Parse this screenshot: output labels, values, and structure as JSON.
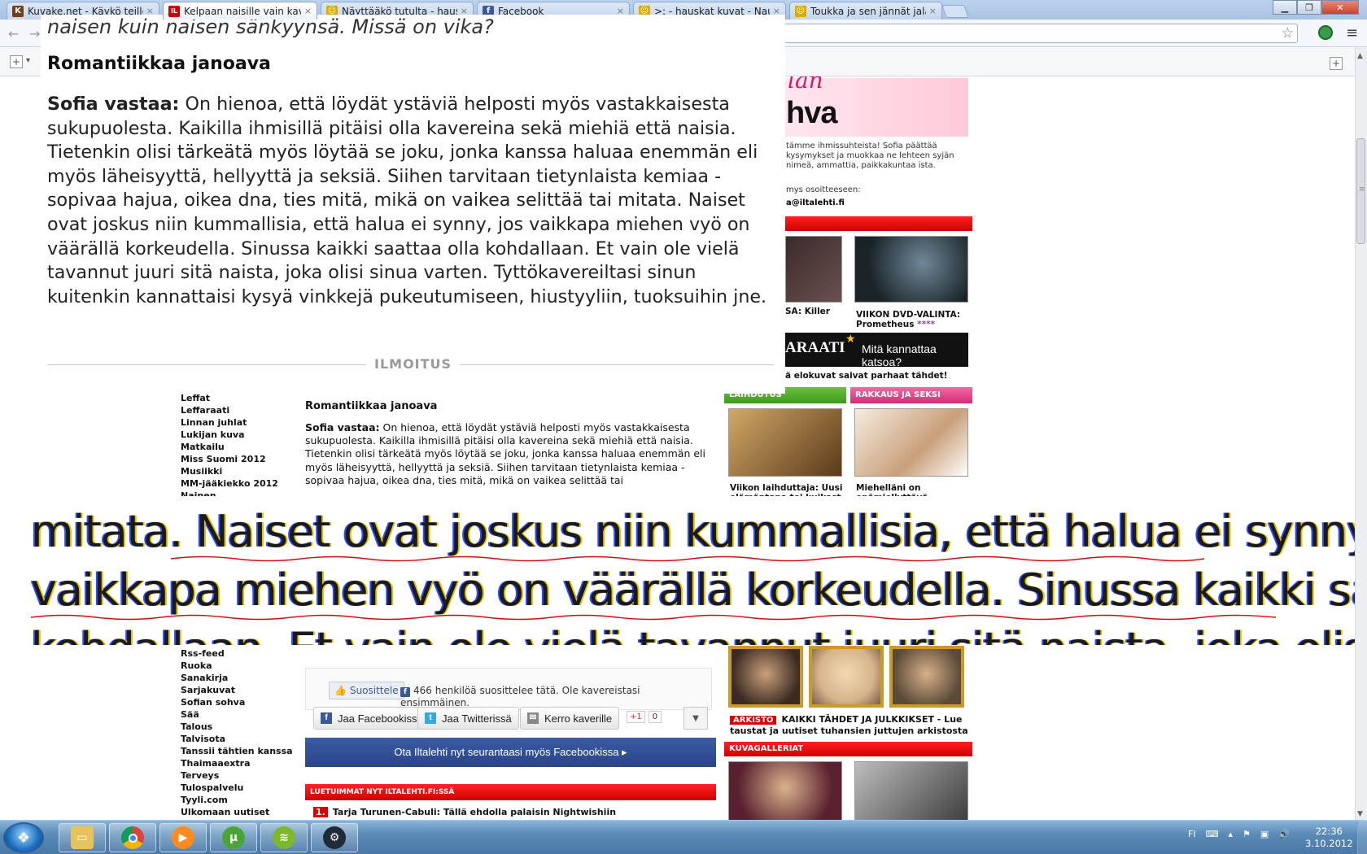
{
  "tabs": [
    {
      "label": "Kuvake.net - Käykö teille n",
      "fav": "K",
      "favColor": "#7a3b12"
    },
    {
      "label": "Kelpaan naisille vain kaveri",
      "fav": "IL",
      "favColor": "#d40000"
    },
    {
      "label": "Näyttääkö tutulta - hauska",
      "fav": "☺",
      "favColor": "#e0a800"
    },
    {
      "label": "Facebook",
      "fav": "f",
      "favColor": "#3b5998"
    },
    {
      "label": ">: - hauskat kuvat - Nauru",
      "fav": "☺",
      "favColor": "#e0a800"
    },
    {
      "label": "Toukka ja sen jännät jalat -",
      "fav": "☺",
      "favColor": "#e0a800"
    }
  ],
  "tab_close": "×",
  "window": {
    "min": "▁",
    "max": "❐",
    "close": "✕"
  },
  "icons": {
    "back": "←",
    "forward": "→",
    "star": "☆",
    "menu": "≡",
    "add": "+",
    "dropdown": "▾",
    "up": "▲",
    "down": "▼",
    "grip": "≡"
  },
  "magnified_top": {
    "intro_line": "naisen kuin naisen sänkyynsä. Missä on vika?",
    "heading": "Romantiikkaa janoava",
    "answer_label": "Sofia vastaa:",
    "answer_text": " On hienoa, että löydät ystäviä helposti myös vastakkaisesta sukupuolesta. Kaikilla ihmisillä pitäisi olla kavereina sekä miehiä että naisia. Tietenkin olisi tärkeätä myös löytää se joku, jonka kanssa haluaa enemmän eli myös läheisyyttä, hellyyttä ja seksiä. Siihen tarvitaan tietynlaista kemiaa - sopivaa hajua, oikea dna, ties mitä, mikä on vaikea selittää tai mitata. Naiset ovat joskus niin kummallisia, että halua ei synny, jos vaikkapa miehen vyö on väärällä korkeudella. Sinussa kaikki saattaa olla kohdallaan. Et vain ole vielä tavannut juuri sitä naista, joka olisi sinua varten. Tyttökavereiltasi sinun kuitenkin kannattaisi kysyä vinkkejä pukeutumiseen, hiustyyliin, tuoksuihin jne.",
    "ad_label": "ILMOITUS"
  },
  "magnified_band": {
    "line1": "mitata. Naiset ovat joskus niin kummallisia, että halua ei synny, jos",
    "line2": "vaikkapa miehen vyö on väärällä korkeudella. Sinussa kaikki saattaa olla",
    "line3": "kohdallaan. Et vain ole vielä tavannut juuri sitä naista, joka olisi sinua"
  },
  "page": {
    "nav_top": [
      "Leffat",
      "Leffaraati",
      "Linnan juhlat",
      "Lukijan kuva",
      "Matkailu",
      "Miss Suomi 2012",
      "Musiikki",
      "MM-jääkiekko 2012",
      "Nainen"
    ],
    "nav_bottom": [
      "Rss-feed",
      "Ruoka",
      "Sanakirja",
      "Sarjakuvat",
      "Sofian sohva",
      "Sää",
      "Talous",
      "Talvisota",
      "Tanssii tähtien kanssa",
      "Thaimaaextra",
      "Terveys",
      "Tulospalvelu",
      "Tyyli.com",
      "Ulkomaan uutiset"
    ],
    "article_title": "Romantiikkaa janoava",
    "article_label": "Sofia vastaa:",
    "article_text": " On hienoa, että löydät ystäviä helposti myös vastakkaisesta sukupuolesta. Kaikilla ihmisillä pitäisi olla kavereina sekä miehiä että naisia. Tietenkin olisi tärkeätä myös löytää se joku, jonka kanssa haluaa enemmän eli myös läheisyyttä, hellyyttä ja seksiä. Siihen tarvitaan tietynlaista kemiaa - sopivaa hajua, oikea dna, ties mitä, mikä on vaikea selittää tai",
    "promo_title": "hva",
    "promo_script": "lan",
    "promo_text": "tämme ihmissuhteista! Sofia päättää kysymykset ja muokkaa ne lehteen syjän nimeä, ammattia, paikkakuntaa ista.",
    "promo_text2": "mys osoitteeseen:",
    "promo_mail": "a@iltalehti.fi",
    "caption_a": "SA: Killer",
    "caption_b": "VIIKON DVD-VALINTA: Prometheus",
    "caption_b_stars": "****",
    "ad_raati": "ARAATI",
    "ad_raati_sub": "Mitä kannattaa katsoa?",
    "ad_raati_caption": "ä elokuvat saivat parhaat tähdet!",
    "section_green": "LAIHDUTUS",
    "section_pink": "RAKKAUS JA SEKSI",
    "caption_green": "Viikon laihduttaja: Uusi elämäntapa toi kuikast",
    "caption_pink": "Miehelläni on epämiellyttävä",
    "like_button": "Suosittele",
    "like_text": "466 henkilöä suosittelee tätä. Ole kavereistasi ensimmäinen.",
    "share_fb": "Jaa Facebookissa",
    "share_tw": "Jaa Twitterissä",
    "share_mail": "Kerro kaverille",
    "gplus_label": "+1",
    "gplus_count": "0",
    "fb_follow": "Ota Iltalehti nyt seurantaasi myös Facebookissa  ▸",
    "lue_bar": "LUETUIMMAT NYT ILTALEHTI.FI:SSÄ",
    "lue_num": "1.",
    "lue_item": "Tarja Turunen-Cabuli: Tällä ehdolla palaisin Nightwishiin",
    "arkisto_badge": "ARKISTO",
    "arkisto_text": "KAIKKI TÄHDET JA JULKKIKSET - Lue taustat ja uutiset tuhansien juttujen arkistosta",
    "kuva_bar": "KUVAGALLERIAT"
  },
  "taskbar": {
    "lang": "FI",
    "time": "22:36",
    "date": "3.10.2012"
  }
}
